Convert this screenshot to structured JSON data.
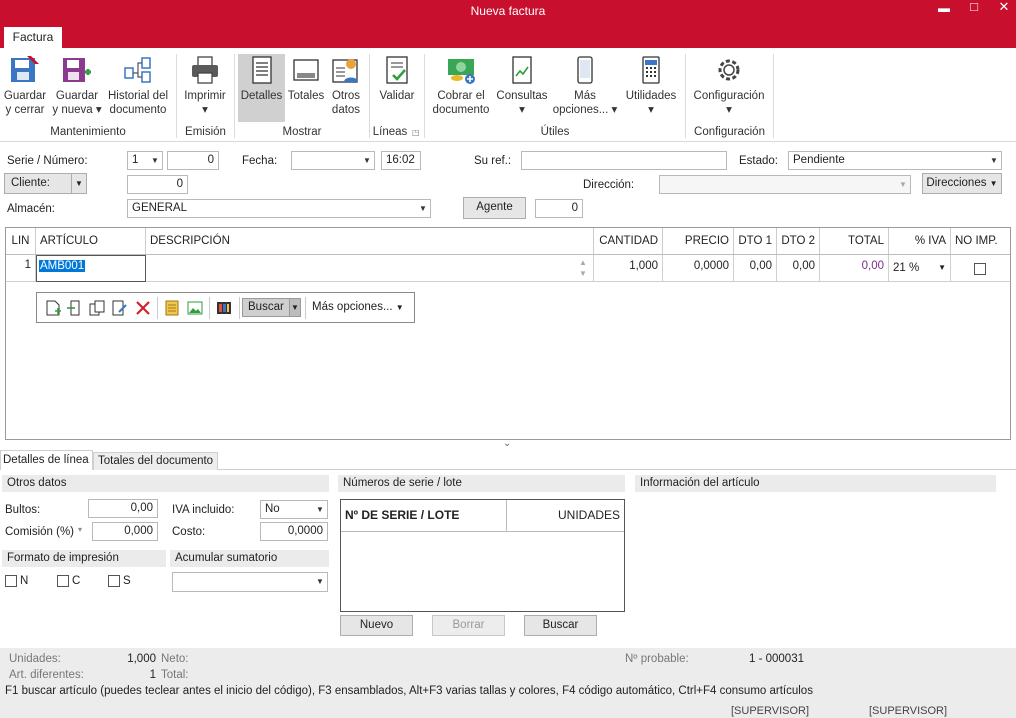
{
  "window": {
    "title": "Nueva factura",
    "minimize": "▬",
    "maximize": "□",
    "close": "✕"
  },
  "ribbon": {
    "tab": "Factura",
    "buttons": {
      "guardar_cerrar": [
        "Guardar",
        "y cerrar"
      ],
      "guardar_nueva": [
        "Guardar",
        "y nueva ▾"
      ],
      "historial": [
        "Historial del",
        "documento"
      ],
      "imprimir": [
        "Imprimir",
        "▾"
      ],
      "detalles": "Detalles",
      "totales": "Totales",
      "otros_datos": [
        "Otros",
        "datos"
      ],
      "validar": "Validar",
      "cobrar": [
        "Cobrar el",
        "documento"
      ],
      "consultas": [
        "Consultas",
        "▾"
      ],
      "mas_opciones": [
        "Más",
        "opciones... ▾"
      ],
      "utilidades": [
        "Utilidades",
        "▾"
      ],
      "configuracion": [
        "Configuración",
        "▾"
      ]
    },
    "groups": {
      "mantenimiento": "Mantenimiento",
      "emision": "Emisión",
      "mostrar": "Mostrar",
      "lineas": "Líneas",
      "utiles": "Útiles",
      "configuracion": "Configuración"
    }
  },
  "header": {
    "serie_label": "Serie / Número:",
    "serie_value": "1",
    "numero_value": "0",
    "fecha_label": "Fecha:",
    "fecha_value": "",
    "hora_value": "16:02",
    "su_ref_label": "Su ref.:",
    "su_ref_value": "",
    "estado_label": "Estado:",
    "estado_value": "Pendiente",
    "cliente_label": "Cliente:",
    "cliente_value": "0",
    "direccion_label": "Dirección:",
    "direccion_value": "",
    "direcciones_label": "Direcciones",
    "almacen_label": "Almacén:",
    "almacen_value": "GENERAL",
    "agente_label": "Agente",
    "agente_value": "0"
  },
  "grid": {
    "columns": [
      "LIN",
      "ARTÍCULO",
      "DESCRIPCIÓN",
      "CANTIDAD",
      "PRECIO",
      "DTO 1",
      "DTO 2",
      "TOTAL",
      "% IVA",
      "NO IMP."
    ],
    "rows": [
      {
        "lin": "1",
        "articulo": "AMB001",
        "descripcion": "",
        "cantidad": "1,000",
        "precio": "0,0000",
        "dto1": "0,00",
        "dto2": "0,00",
        "total": "0,00",
        "iva": "21 %"
      }
    ],
    "toolbar": {
      "buscar": "Buscar",
      "mas_opciones": "Más opciones..."
    }
  },
  "bottom": {
    "tabs": [
      "Detalles de línea",
      "Totales del documento"
    ],
    "otros_datos": {
      "title": "Otros datos",
      "bultos_label": "Bultos:",
      "bultos_value": "0,00",
      "comision_label": "Comisión (%)",
      "comision_value": "0,000",
      "iva_incl_label": "IVA incluido:",
      "iva_incl_value": "No",
      "coste_label": "Costo:",
      "coste_value": "0,0000"
    },
    "formato": {
      "title": "Formato de impresión",
      "options": [
        "N",
        "C",
        "S"
      ]
    },
    "acumular": {
      "title": "Acumular sumatorio",
      "value": ""
    },
    "series": {
      "title": "Números de serie / lote",
      "col1": "Nº DE SERIE / LOTE",
      "col2": "UNIDADES",
      "nuevo": "Nuevo",
      "borrar": "Borrar",
      "buscar": "Buscar"
    },
    "info": {
      "title": "Información del artículo"
    }
  },
  "footer": {
    "unidades_label": "Unidades:",
    "unidades_value": "1,000",
    "neto_label": "Neto:",
    "art_dif_label": "Art. diferentes:",
    "art_dif_value": "1",
    "total_label": "Total:",
    "nprob_label": "Nº probable:",
    "nprob_value": "1 - 000031",
    "hint": "F1 buscar artículo (puedes teclear antes el inicio del código), F3 ensamblados, Alt+F3 varias tallas y colores, F4 código automático, Ctrl+F4 consumo artículos",
    "status1": "[SUPERVISOR]",
    "status2": "[SUPERVISOR]"
  },
  "colors": {
    "brand": "#c8102e",
    "active_button": "#d0d0d0",
    "selection": "#0078d7"
  }
}
